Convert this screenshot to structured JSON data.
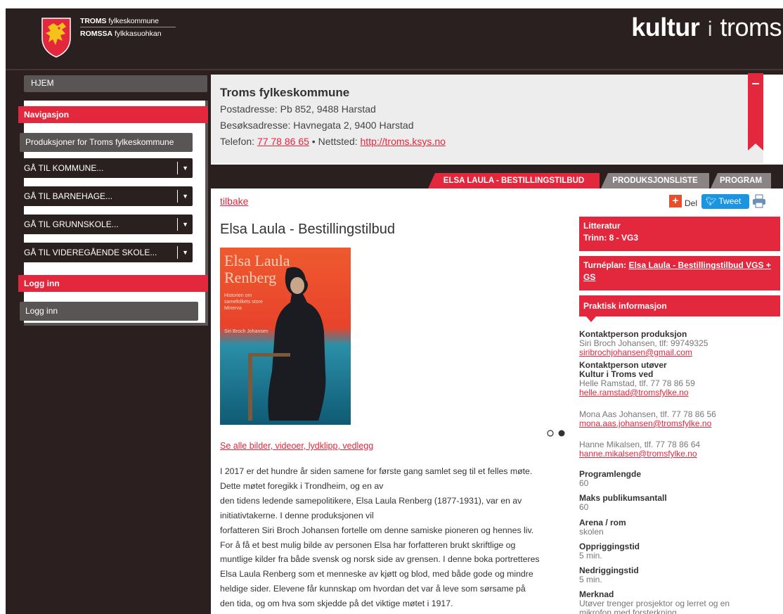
{
  "header": {
    "org_line1_bold": "TROMS",
    "org_line1_rest": " fylkeskommune",
    "org_line2_bold": "ROMSSA",
    "org_line2_rest": " fylkkasuohkan",
    "brand_part1": "kultur",
    "brand_part2": "i",
    "brand_part3": "troms"
  },
  "sidebar": {
    "home": "HJEM",
    "nav_heading": "Navigasjon",
    "productions_button": "Produksjoner for Troms fylkeskommune",
    "dropdowns": [
      "GÅ TIL KOMMUNE...",
      "GÅ TIL BARNEHAGE...",
      "GÅ TIL GRUNNSKOLE...",
      "GÅ TIL VIDEREGÅENDE SKOLE..."
    ],
    "login_heading": "Logg inn",
    "login_button": "Logg inn"
  },
  "info": {
    "title": "Troms fylkeskommune",
    "postal": "Postadresse: Pb 852, 9488 Harstad",
    "visit": "Besøksadresse: Havnegata 2, 9400 Harstad",
    "phone_label": "Telefon: ",
    "phone": "77 78 86 65",
    "web_sep": " • Nettsted: ",
    "web": "http://troms.ksys.no"
  },
  "tabs": [
    "ELSA LAULA - BESTILLINGSTILBUD",
    "PRODUKSJONSLISTE",
    "PROGRAM"
  ],
  "content": {
    "back": "tilbake",
    "share_label": "Del",
    "tweet_label": "Tweet",
    "title": "Elsa Laula - Bestillingstilbud",
    "cover_title1": "Elsa Laula",
    "cover_title2": "Renberg",
    "cover_subtitle": "Historien om samefolkets store Minerva",
    "cover_author": "Siri Broch Johansen",
    "gallery_link": "Se alle bilder, videoer, lydklipp, vedlegg",
    "body_lines": [
      "I 2017 er det hundre år siden samene for første gang samlet seg til et felles møte.",
      "Dette møtet foregikk i Trondheim, og en av",
      "den tidens ledende samepolitikere, Elsa Laula Renberg (1877-1931), var en av",
      "initiativtakerne. I denne produksjonen vil",
      "forfatteren Siri Broch Johansen fortelle om denne samiske pioneren og hennes liv.",
      "For å få et best mulig bilde av personen Elsa har forfatteren brukt skriftlige og",
      "muntlige kilder fra både svensk og norsk side av grensen. I denne boka portretteres",
      "Elsa Laula Renberg som et menneske av kjøtt og blod, med både gode og mindre",
      "heldige sider. Elevene får kunnskap om hvordan det var å leve som sørsame på",
      "den tida, og om hva som skjedde på det viktige møtet i 1917."
    ]
  },
  "right": {
    "genre": "Litteratur",
    "level": "Trinn: 8 - VG3",
    "tour_label": "Turnéplan: ",
    "tour_link": "Elsa Laula - Bestillingstilbud VGS + GS",
    "practical": "Praktisk informasjon",
    "contact_prod_label": "Kontaktperson produksjon",
    "contact_prod_name": "Siri Broch Johansen, tlf: 99749325",
    "contact_prod_email": "siribrochjohansen@gmail.com",
    "contact_perf_label": "Kontaktperson utøver",
    "contact_perf_org": "Kultur i Troms ved",
    "contact1_name": "Helle Ramstad, tlf. 77 78 86 59",
    "contact1_email": "helle.ramstad@tromsfylke.no",
    "contact2_name": "Mona Aas Johansen, tlf. 77 78 86 56",
    "contact2_email": "mona.aas.johansen@tromsfylke.no",
    "contact3_name": "Hanne Mikalsen, tlf. 77 78 86 64",
    "contact3_email": "hanne.mikalsen@tromsfylke.no",
    "length_label": "Programlengde",
    "length_value": "60",
    "max_label": "Maks publikumsantall",
    "max_value": "60",
    "arena_label": "Arena / rom",
    "arena_value": "skolen",
    "setup_label": "Oppriggingstid",
    "setup_value": "5 min.",
    "teardown_label": "Nedriggingstid",
    "teardown_value": "5 min.",
    "note_label": "Merknad",
    "note_line1": "Utøver trenger prosjektor og lerret og en",
    "note_line2": "mikrofon med forsterkning"
  },
  "colors": {
    "accent": "#e3273d",
    "dark": "#2b2020",
    "twitter": "#1b95e0"
  }
}
